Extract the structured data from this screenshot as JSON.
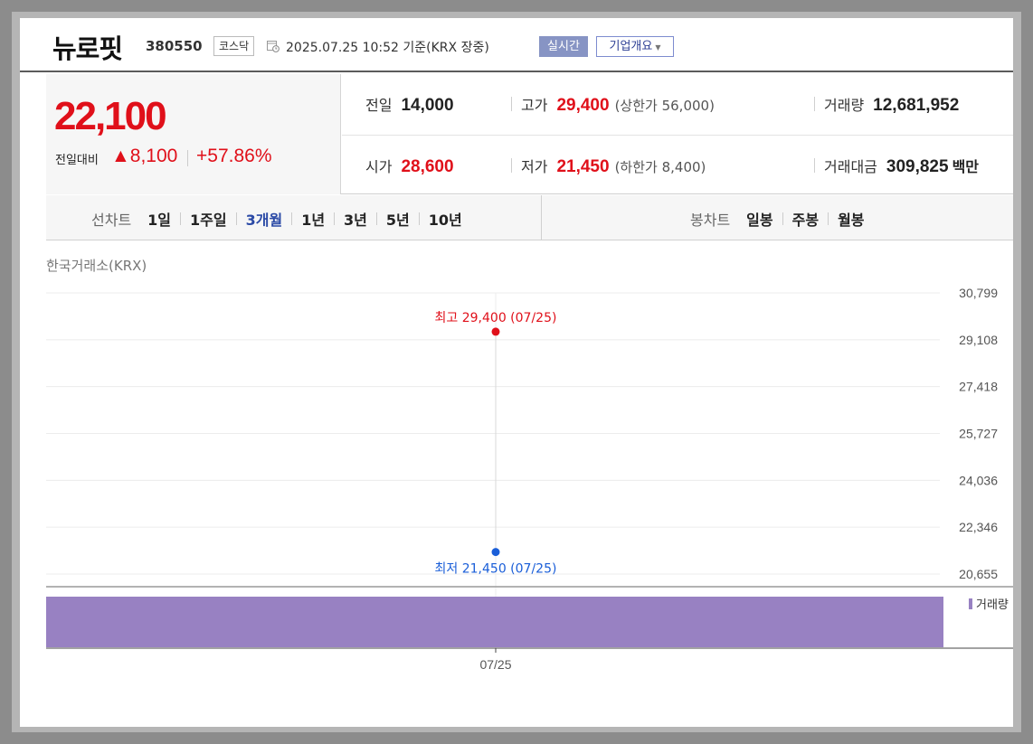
{
  "header": {
    "stock_name": "뉴로핏",
    "stock_code": "380550",
    "market_badge": "코스닥",
    "datetime": "2025.07.25 10:52 기준(KRX 장중)",
    "realtime_button": "실시간",
    "company_button": "기업개요"
  },
  "quote": {
    "price": "22,100",
    "change_label": "전일대비",
    "change_amount": "▲8,100",
    "change_percent": "+57.86%",
    "prev_close_label": "전일",
    "prev_close": "14,000",
    "high_label": "고가",
    "high": "29,400",
    "upper_limit": "(상한가 56,000)",
    "volume_label": "거래량",
    "volume": "12,681,952",
    "open_label": "시가",
    "open": "28,600",
    "low_label": "저가",
    "low": "21,450",
    "lower_limit": "(하한가 8,400)",
    "value_label": "거래대금",
    "value": "309,825",
    "value_unit": "백만",
    "up_color": "#e0101a"
  },
  "tabs": {
    "line_chart_label": "선차트",
    "line_options": [
      "1일",
      "1주일",
      "3개월",
      "1년",
      "3년",
      "5년",
      "10년"
    ],
    "line_active": "3개월",
    "candle_chart_label": "봉차트",
    "candle_options": [
      "일봉",
      "주봉",
      "월봉"
    ]
  },
  "chart_data": {
    "type": "line",
    "source": "한국거래소(KRX)",
    "yticks": [
      "30,799",
      "29,108",
      "27,418",
      "25,727",
      "24,036",
      "22,346",
      "20,655"
    ],
    "ylim": [
      20655,
      30799
    ],
    "x": [
      "07/25"
    ],
    "high": {
      "label": "최고 29,400 (07/25)",
      "value": 29400,
      "date": "07/25",
      "color": "#e0101a"
    },
    "low": {
      "label": "최저 21,450 (07/25)",
      "value": 21450,
      "date": "07/25",
      "color": "#1a5ed8"
    },
    "volume": {
      "label": "거래량",
      "values": [
        12681952
      ],
      "color": "#9881c2"
    }
  }
}
